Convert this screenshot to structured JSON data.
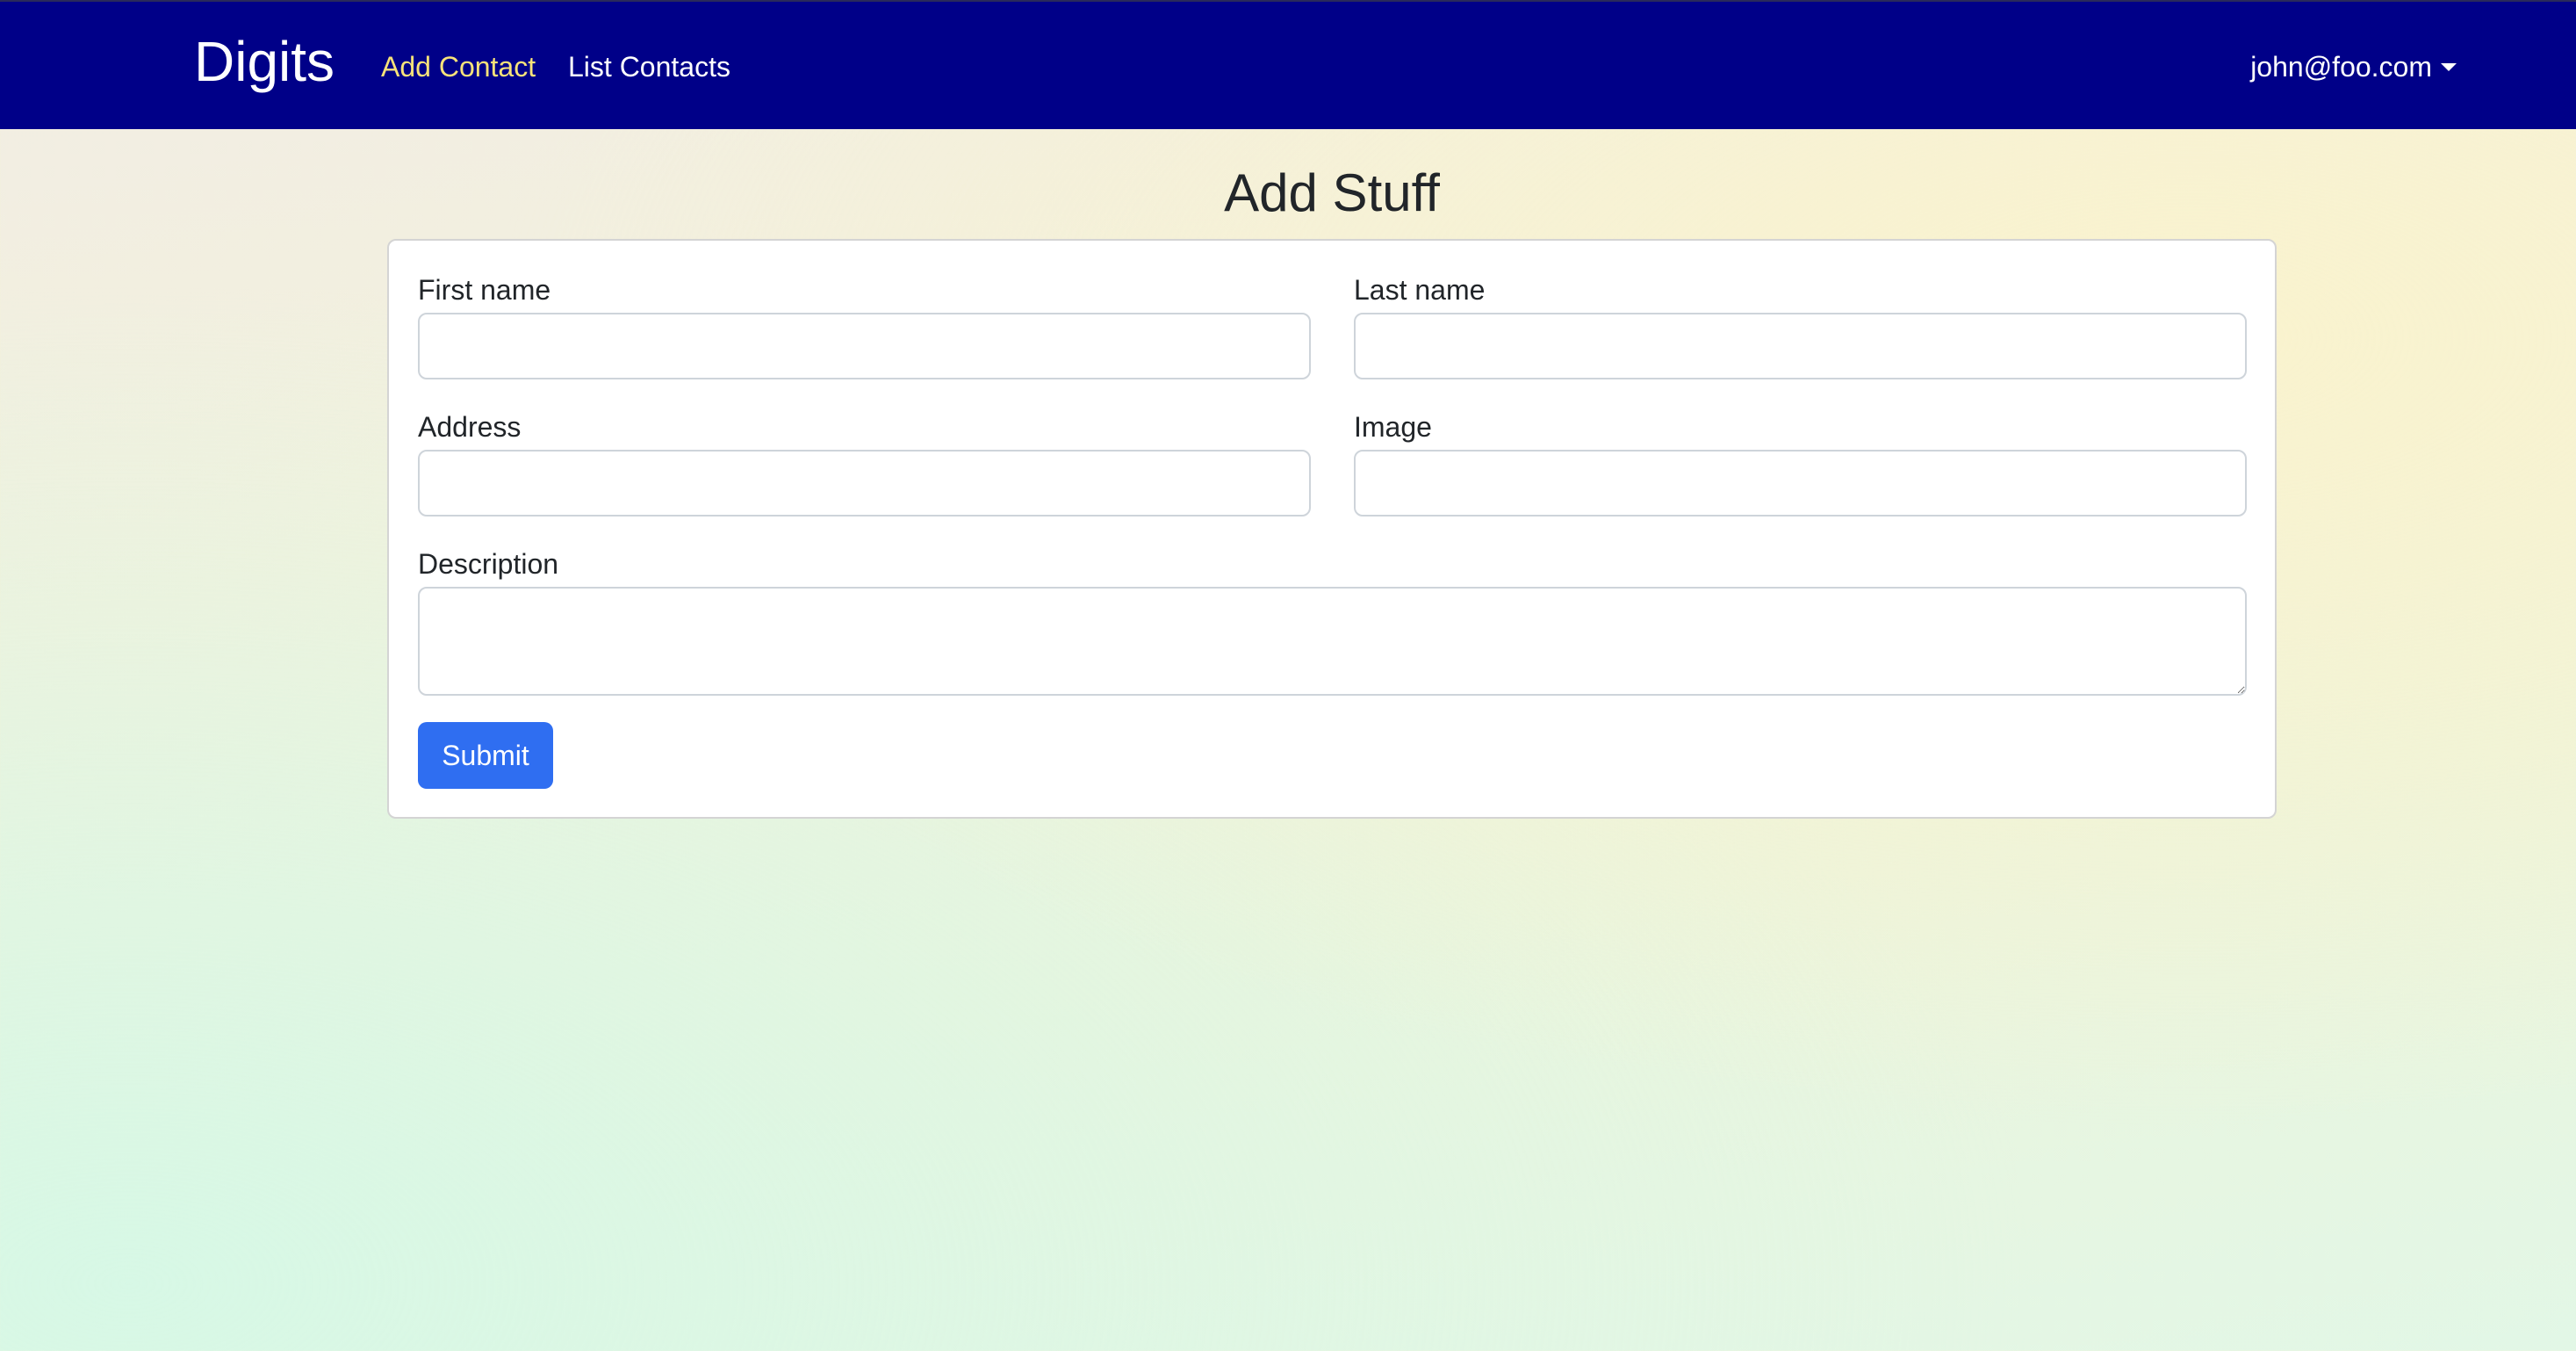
{
  "navbar": {
    "brand": "Digits",
    "links": [
      {
        "label": "Add Contact",
        "active": true
      },
      {
        "label": "List Contacts",
        "active": false
      }
    ],
    "user": "john@foo.com"
  },
  "page": {
    "title": "Add Stuff"
  },
  "form": {
    "first_name": {
      "label": "First name",
      "value": ""
    },
    "last_name": {
      "label": "Last name",
      "value": ""
    },
    "address": {
      "label": "Address",
      "value": ""
    },
    "image": {
      "label": "Image",
      "value": ""
    },
    "description": {
      "label": "Description",
      "value": ""
    },
    "submit_label": "Submit"
  },
  "colors": {
    "navbar_bg": "#000088",
    "active_link": "#f7e27a",
    "primary_button": "#2f6ef1"
  }
}
